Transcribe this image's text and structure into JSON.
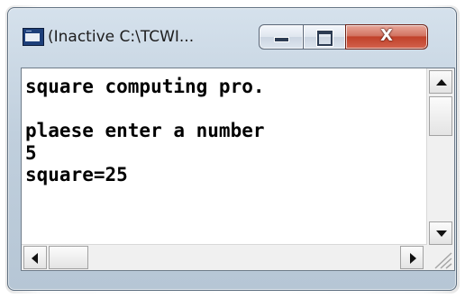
{
  "window": {
    "title": "(Inactive C:\\TCWI..."
  },
  "console": {
    "lines": [
      "square computing pro.",
      "",
      "plaese enter a number",
      "5",
      "square=25"
    ]
  },
  "icons": {
    "app": "console-window-icon",
    "minimize": "minimize-icon",
    "maximize": "maximize-icon",
    "close": "close-icon",
    "close_glyph": "X"
  }
}
